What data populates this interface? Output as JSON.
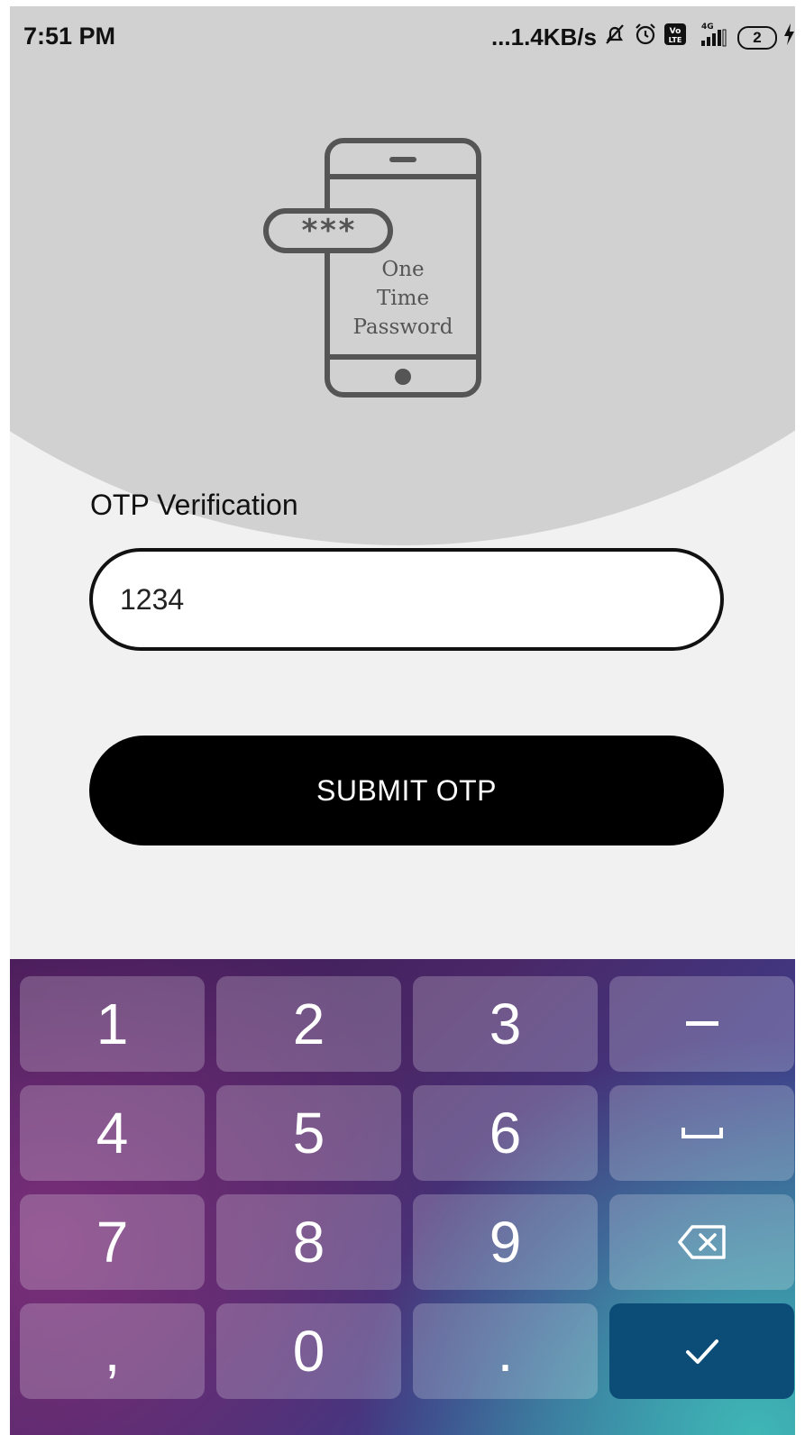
{
  "status_bar": {
    "time": "7:51 PM",
    "network_speed": "...1.4KB/s",
    "network_type": "4G",
    "volte_badge": "Vo LTE",
    "battery_level": "2",
    "icons": [
      "muted-bell-icon",
      "alarm-icon",
      "volte-icon",
      "signal-icon",
      "battery-icon",
      "charging-icon"
    ]
  },
  "illustration": {
    "password_mask": "***",
    "caption_line1": "One",
    "caption_line2": "Time",
    "caption_line3": "Password"
  },
  "otp": {
    "label": "OTP Verification",
    "value": "1234"
  },
  "submit": {
    "label": "SUBMIT OTP"
  },
  "keyboard": {
    "keys": [
      "1",
      "2",
      "3",
      "–",
      "4",
      "5",
      "6",
      "␣",
      "7",
      "8",
      "9",
      "⌫",
      ",",
      "0",
      ".",
      "✓"
    ]
  },
  "colors": {
    "hero": "#d1d1d1",
    "background": "#f1f1f1",
    "button": "#000000",
    "done_key": "#0c4d78"
  }
}
